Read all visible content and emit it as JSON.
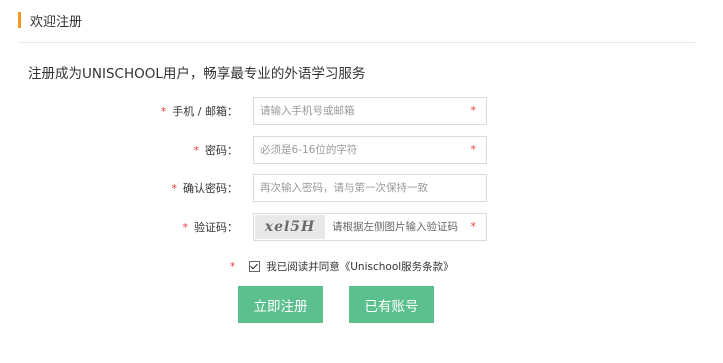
{
  "header": {
    "title": "欢迎注册"
  },
  "subtitle": "注册成为UNISCHOOL用户，畅享最专业的外语学习服务",
  "form": {
    "required_mark": "*",
    "account": {
      "label": "手机 / 邮箱：",
      "placeholder": "请输入手机号或邮箱"
    },
    "password": {
      "label": "密码：",
      "placeholder": "必须是6-16位的字符"
    },
    "confirm": {
      "label": "确认密码：",
      "placeholder": "再次输入密码，请与第一次保持一致"
    },
    "captcha": {
      "label": "验证码：",
      "image_text": "xel5H",
      "placeholder": "请根据左侧图片输入验证码"
    },
    "agreement": {
      "text": "我已阅读并同意《Unischool服务条款》",
      "checked": true
    }
  },
  "buttons": {
    "register": "立即注册",
    "login": "已有账号"
  },
  "colors": {
    "accent": "#f39a1f",
    "button": "#5cc08e",
    "required": "#e8413b"
  }
}
